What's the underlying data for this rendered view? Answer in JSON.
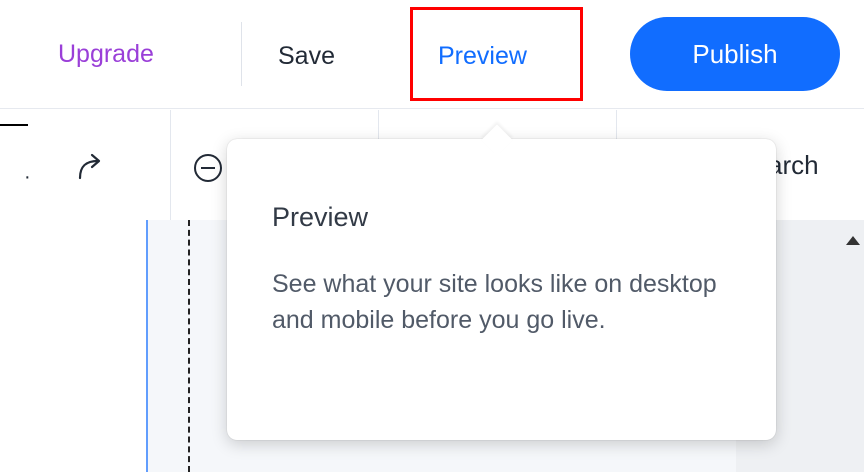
{
  "header": {
    "upgrade_label": "Upgrade",
    "save_label": "Save",
    "preview_label": "Preview",
    "publish_label": "Publish",
    "accent_color": "#116dff",
    "upgrade_color": "#9a3fd8",
    "highlight_color": "#ff0000"
  },
  "toolbar": {
    "undo_partial": "·",
    "search_partial": "arch"
  },
  "tooltip": {
    "title": "Preview",
    "body": "See what your site looks like on desktop and mobile before you go live."
  },
  "icons": {
    "redo": "redo-arrow",
    "zoom_out": "circle-minus"
  }
}
